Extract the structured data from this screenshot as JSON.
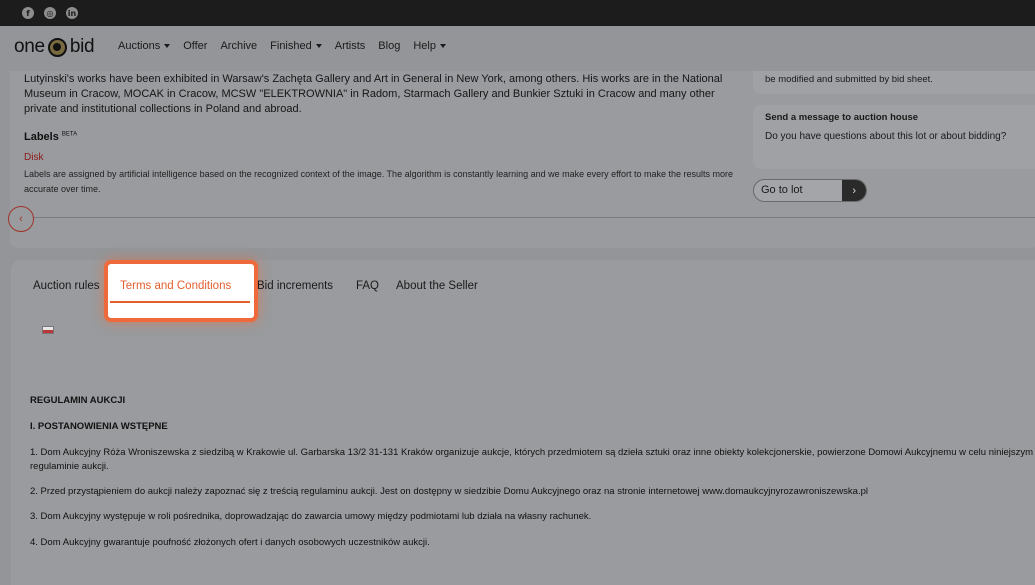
{
  "social": [
    "facebook-icon",
    "instagram-icon",
    "linkedin-icon"
  ],
  "logo": {
    "left": "one",
    "right": "bid"
  },
  "nav": [
    {
      "label": "Auctions",
      "dropdown": true
    },
    {
      "label": "Offer",
      "dropdown": false
    },
    {
      "label": "Archive",
      "dropdown": false
    },
    {
      "label": "Finished",
      "dropdown": true
    },
    {
      "label": "Artists",
      "dropdown": false
    },
    {
      "label": "Blog",
      "dropdown": false
    },
    {
      "label": "Help",
      "dropdown": true
    }
  ],
  "description": "Lutyinski's works have been exhibited in Warsaw's Zachęta Gallery and Art in General in New York, among others. His works are in the National Museum in Cracow, MOCAK in Cracow, MCSW \"ELEKTROWNIA\" in Radom, Starmach Gallery and Bunkier Sztuki in Cracow and many other private and institutional collections in Poland and abroad.",
  "labels": {
    "title": "Labels",
    "badge": "BETA",
    "tag": "Disk",
    "note": "Labels are assigned by artificial intelligence based on the recognized context of the image. The algorithm is constantly learning and we make every effort to make the results more accurate over time."
  },
  "side": {
    "bid_note": "be modified and submitted by bid sheet.",
    "message_title": "Send a message to auction house",
    "message_text": "Do you have questions about this lot or about bidding?",
    "goto_label": "Go to lot",
    "goto_arrow": "›"
  },
  "carousel": {
    "prev": "‹"
  },
  "tabs": {
    "auction_rules": "Auction rules",
    "terms": "Terms and Conditions",
    "bid_increments": "Bid increments",
    "faq": "FAQ",
    "about_seller": "About the Seller"
  },
  "terms": {
    "title": "REGULAMIN AUKCJI",
    "section": "I. POSTANOWIENIA WSTĘPNE",
    "items": [
      "1.   Dom Aukcyjny Róża Wroniszewska z siedzibą w Krakowie ul. Garbarska 13/2 31-131 Kraków organizuje aukcje, których przedmiotem są dzieła sztuki oraz inne obiekty kolekcjonerskie, powierzone Domowi Aukcyjnemu w celu niniejszym regulaminie aukcji.",
      "2.   Przed przystąpieniem do aukcji należy zapoznać się z treścią regulaminu aukcji. Jest on dostępny w siedzibie Domu Aukcyjnego oraz na stronie internetowej www.domaukcyjnyrozawroniszewska.pl",
      "3.   Dom Aukcyjny występuje w roli pośrednika, doprowadzając do zawarcia umowy między podmiotami lub działa na własny rachunek.",
      "4.   Dom Aukcyjny gwarantuje poufność złożonych ofert i danych osobowych uczestników aukcji."
    ]
  },
  "colors": {
    "accent": "#e45e2e",
    "highlight_border": "#ee6a3d",
    "overlay": "#939598"
  }
}
